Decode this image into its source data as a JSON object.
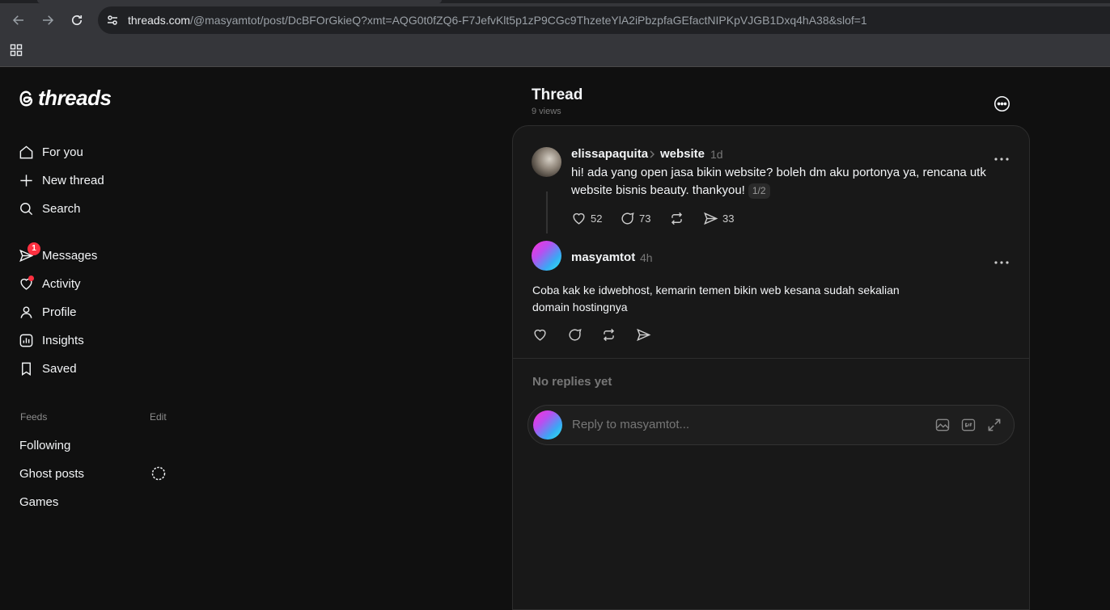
{
  "browser": {
    "url_host": "threads.com",
    "url_path": "/@masyamtot/post/DcBFOrGkieQ?xmt=AQG0t0fZQ6-F7JefvKlt5p1zP9CGc9ThzeteYlA2iPbzpfaGEfactNIPKpVJGB1Dxq4hA38&slof=1"
  },
  "logo": {
    "text": "threads"
  },
  "sidebar": {
    "for_you": "For you",
    "new_thread": "New thread",
    "search": "Search",
    "messages": "Messages",
    "messages_badge": "1",
    "activity": "Activity",
    "profile": "Profile",
    "insights": "Insights",
    "saved": "Saved",
    "feeds_label": "Feeds",
    "edit_label": "Edit",
    "feeds": [
      "Following",
      "Ghost posts",
      "Games"
    ]
  },
  "thread": {
    "title": "Thread",
    "views": "9 views"
  },
  "parent_post": {
    "username": "elissapaquita",
    "topic": "website",
    "time": "1d",
    "text_line1": "hi! ada yang open jasa bikin website? boleh dm aku portonya ya, rencana utk",
    "text_line2": "website bisnis beauty. thankyou!",
    "pager": "1/2",
    "likes": "52",
    "comments": "73",
    "shares": "33"
  },
  "reply_post": {
    "username": "masyamtot",
    "time": "4h",
    "text_line1": "Coba kak ke idwebhost, kemarin temen bikin web kesana sudah sekalian",
    "text_line2": "domain hostingnya"
  },
  "replies": {
    "empty_text": "No replies yet",
    "placeholder": "Reply to masyamtot..."
  }
}
